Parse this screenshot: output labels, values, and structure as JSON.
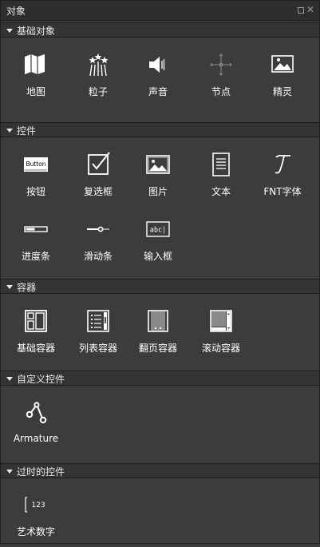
{
  "panel": {
    "title": "对象"
  },
  "sections": [
    {
      "title": "基础对象",
      "items": [
        "地图",
        "粒子",
        "声音",
        "节点",
        "精灵"
      ]
    },
    {
      "title": "控件",
      "items": [
        "按钮",
        "复选框",
        "图片",
        "文本",
        "FNT字体",
        "进度条",
        "滑动条",
        "输入框"
      ]
    },
    {
      "title": "容器",
      "items": [
        "基础容器",
        "列表容器",
        "翻页容器",
        "滚动容器"
      ]
    },
    {
      "title": "自定义控件",
      "items": [
        "Armature"
      ]
    },
    {
      "title": "过时的控件",
      "items": [
        "艺术数字"
      ]
    }
  ],
  "icon_text": {
    "button": "Button",
    "input": "abc|",
    "atlas": "123"
  },
  "colors": {
    "background": "#3c3c3e",
    "header": "#343436",
    "titlebar": "#2e2e30",
    "icon": "#ffffff"
  }
}
